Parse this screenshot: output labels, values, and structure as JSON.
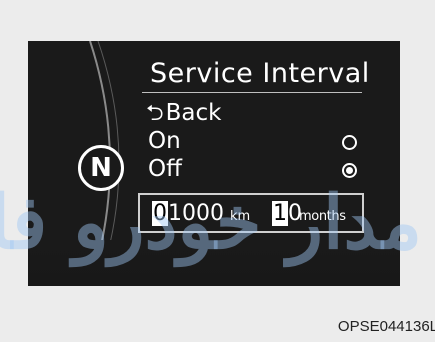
{
  "screen": {
    "title": "Service Interval",
    "gear": "N",
    "back_label": "Back",
    "back_icon": "return-arrow-icon",
    "options": [
      {
        "label": "On",
        "selected": false
      },
      {
        "label": "Off",
        "selected": true
      }
    ],
    "interval": {
      "distance_highlight": "0",
      "distance_rest": "1000",
      "distance_unit": "km",
      "months_highlight": "1",
      "months_rest": "0",
      "months_unit": "months"
    }
  },
  "watermark_text": "مدار خودرو فارما",
  "caption": "OPSE044136L"
}
